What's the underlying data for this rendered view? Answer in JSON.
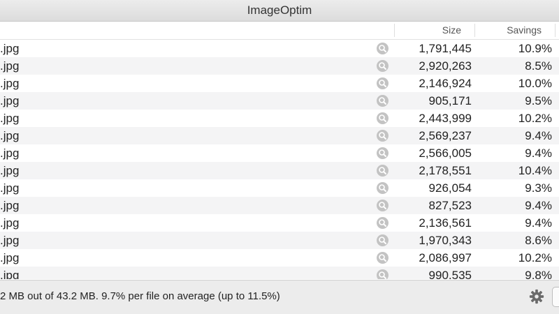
{
  "window": {
    "title": "ImageOptim"
  },
  "columns": {
    "size": "Size",
    "savings": "Savings"
  },
  "files": [
    {
      "name": ".jpg",
      "size": "1,791,445",
      "savings": "10.9%"
    },
    {
      "name": ".jpg",
      "size": "2,920,263",
      "savings": "8.5%"
    },
    {
      "name": ".jpg",
      "size": "2,146,924",
      "savings": "10.0%"
    },
    {
      "name": ".jpg",
      "size": "905,171",
      "savings": "9.5%"
    },
    {
      "name": ".jpg",
      "size": "2,443,999",
      "savings": "10.2%"
    },
    {
      "name": ".jpg",
      "size": "2,569,237",
      "savings": "9.4%"
    },
    {
      "name": ".jpg",
      "size": "2,566,005",
      "savings": "9.4%"
    },
    {
      "name": ".jpg",
      "size": "2,178,551",
      "savings": "10.4%"
    },
    {
      "name": ".jpg",
      "size": "926,054",
      "savings": "9.3%"
    },
    {
      "name": ".jpg",
      "size": "827,523",
      "savings": "9.4%"
    },
    {
      "name": ".jpg",
      "size": "2,136,561",
      "savings": "9.4%"
    },
    {
      "name": ".jpg",
      "size": "1,970,343",
      "savings": "8.6%"
    },
    {
      "name": ".jpg",
      "size": "2,086,997",
      "savings": "10.2%"
    },
    {
      "name": ".jpg",
      "size": "990,535",
      "savings": "9.8%"
    }
  ],
  "row_icon": "magnifier-icon",
  "footer": {
    "summary": "2 MB out of 43.2 MB. 9.7% per file on average (up to 11.5%)",
    "settings_icon": "gear-icon"
  },
  "colors": {
    "title_bar": "#e4e4e4",
    "row_stripe": "#f4f4f5",
    "magnifier": "#c3c3c3",
    "footer": "#ececec"
  }
}
